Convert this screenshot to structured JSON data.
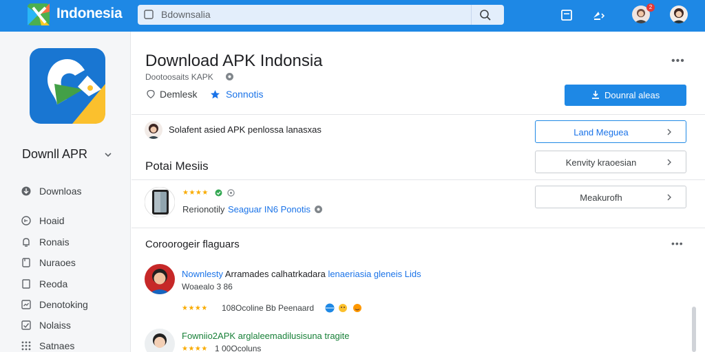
{
  "header": {
    "brand": "Indonesia",
    "search": {
      "value": "Bdownsalia"
    }
  },
  "sidebar": {
    "title": "Downll APR",
    "items": [
      {
        "label": "Downloas",
        "icon": "download-icon"
      },
      {
        "label": "Hoaid",
        "icon": "home-icon"
      },
      {
        "label": "Ronais",
        "icon": "bell-icon"
      },
      {
        "label": "Nuraoes",
        "icon": "file-icon"
      },
      {
        "label": "Reoda",
        "icon": "page-icon"
      },
      {
        "label": "Denotoking",
        "icon": "chart-icon"
      },
      {
        "label": "Nolaiss",
        "icon": "check-icon"
      },
      {
        "label": "Satnaes",
        "icon": "grid-icon"
      }
    ]
  },
  "app": {
    "title": "Download APK Indonsia",
    "subtitle": "Dootoosaits KAPK",
    "meta_location": "Demlesk",
    "meta_rating": "Sonnotis",
    "download_button": "Dounral aleas"
  },
  "notice": {
    "text": "Solafent asied APK penlossa lanasxas"
  },
  "side_buttons": {
    "primary": "Land Meguea",
    "secondary": "Kenvity kraoesian",
    "third": "Meakurofh"
  },
  "sections": {
    "first_title": "Potai Mesiis",
    "second_title": "Coroorogeir flaguars"
  },
  "review": {
    "stars": "★★★★",
    "author": "Rerionotily",
    "link": "Seaguar IN6 Ponotis"
  },
  "comments": [
    {
      "title_a": "Nownlesty",
      "title_b": " Arramades calhatrkadara ",
      "title_c": "lenaeriasia gleneis Lids",
      "sub": "Woaealo 3 86",
      "stars": "★★★★",
      "meta": "108Ocoline Bb Peenaard"
    },
    {
      "title_a": "Fowniio2APK arglaleemadilusisuna tragite",
      "stars": "★★★★",
      "meta": "1 00Ocoluns"
    }
  ],
  "colors": {
    "brand_blue": "#1e88e5",
    "link_blue": "#1a73e8",
    "star_gold": "#f9ab00",
    "badge_red": "#e53935"
  }
}
